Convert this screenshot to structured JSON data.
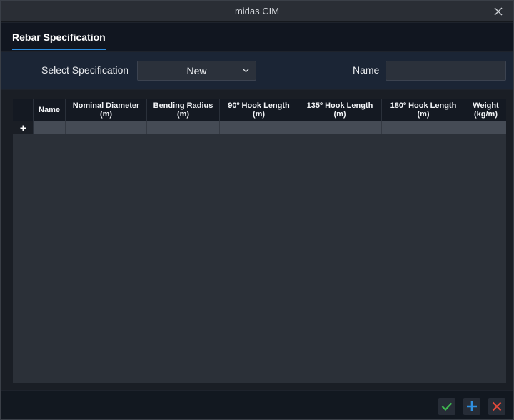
{
  "window": {
    "title": "midas CIM"
  },
  "tabs": [
    {
      "label": "Rebar Specification"
    }
  ],
  "spec": {
    "select_label": "Select Specification",
    "selected_value": "New",
    "name_label": "Name",
    "name_value": ""
  },
  "table": {
    "columns": [
      {
        "line1": "Name",
        "line2": ""
      },
      {
        "line1": "Nominal Diameter",
        "line2": "(m)"
      },
      {
        "line1": "Bending Radius",
        "line2": "(m)"
      },
      {
        "line1": "90º Hook Length",
        "line2": "(m)"
      },
      {
        "line1": "135º Hook Length",
        "line2": "(m)"
      },
      {
        "line1": "180º Hook Length",
        "line2": "(m)"
      },
      {
        "line1": "Weight",
        "line2": "(kg/m)"
      }
    ],
    "rows": []
  },
  "colors": {
    "accent": "#2f8fe0",
    "confirm": "#3fb950",
    "add": "#2f8fe0",
    "cancel": "#e0493b"
  },
  "icons": {
    "close": "close-icon",
    "dropdown": "chevron-down-icon",
    "add_row": "plus-icon",
    "confirm": "check-icon",
    "add": "plus-icon",
    "cancel": "x-icon"
  }
}
